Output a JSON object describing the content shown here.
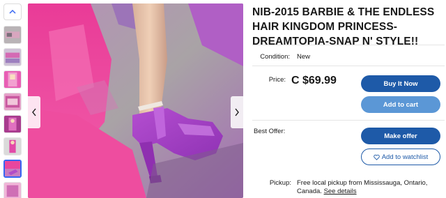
{
  "listing": {
    "title": "NIB-2015 BARBIE & THE ENDLESS HAIR KINGDOM PRINCESS-DREAMTOPIA-SNAP N' STYLE!!",
    "condition_label": "Condition:",
    "condition_value": "New",
    "price_label": "Price:",
    "price_value": "C $69.99",
    "best_offer_label": "Best Offer:",
    "pickup_label": "Pickup:",
    "pickup_value": "Free local pickup from Mississauga, Ontario, Canada.",
    "pickup_link": "See details"
  },
  "actions": {
    "buy_now": "Buy It Now",
    "add_to_cart": "Add to cart",
    "make_offer": "Make offer",
    "add_to_watchlist": "Add to watchlist"
  },
  "gallery": {
    "thumbnail_count": 9,
    "selected_index": 7
  },
  "colors": {
    "primary": "#1e5aa8",
    "secondary": "#5b97d6",
    "selected_thumb": "#3665f3"
  },
  "icons": {
    "scroll_up": "chevron-up-icon",
    "prev": "chevron-left-icon",
    "next": "chevron-right-icon",
    "watch": "heart-icon"
  }
}
